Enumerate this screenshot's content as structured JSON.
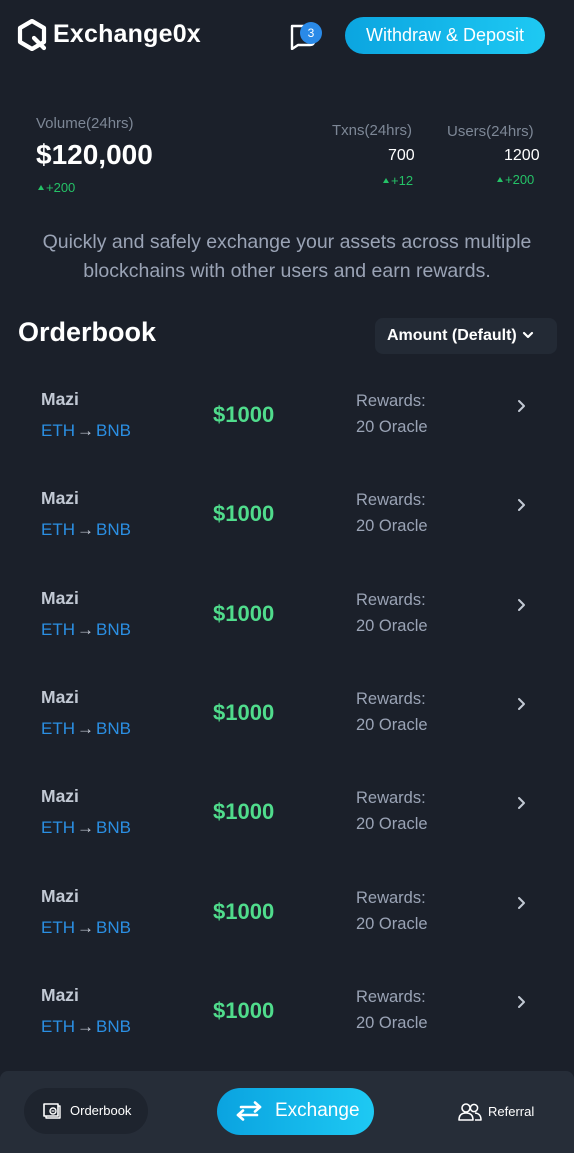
{
  "app": {
    "title": "Exchange0x"
  },
  "header": {
    "notification_count": "3",
    "withdraw_deposit_label": "Withdraw & Deposit"
  },
  "stats": {
    "volume": {
      "label": "Volume(24hrs)",
      "value": "$120,000",
      "delta": "+200"
    },
    "txns": {
      "label": "Txns(24hrs)",
      "value": "700",
      "delta": "+12"
    },
    "users": {
      "label": "Users(24hrs)",
      "value": "1200",
      "delta": "+200"
    }
  },
  "tagline": "Quickly and safely exchange your assets across multiple blockchains with other users and earn rewards.",
  "orderbook": {
    "title": "Orderbook",
    "sort_label": "Amount (Default)",
    "orders": [
      {
        "name": "Mazi",
        "from": "ETH",
        "arrow": "→",
        "to": "BNB",
        "amount": "$1000",
        "rewards_label": "Rewards:",
        "rewards_value": "20 Oracle"
      },
      {
        "name": "Mazi",
        "from": "ETH",
        "arrow": "→",
        "to": "BNB",
        "amount": "$1000",
        "rewards_label": "Rewards:",
        "rewards_value": "20 Oracle"
      },
      {
        "name": "Mazi",
        "from": "ETH",
        "arrow": "→",
        "to": "BNB",
        "amount": "$1000",
        "rewards_label": "Rewards:",
        "rewards_value": "20 Oracle"
      },
      {
        "name": "Mazi",
        "from": "ETH",
        "arrow": "→",
        "to": "BNB",
        "amount": "$1000",
        "rewards_label": "Rewards:",
        "rewards_value": "20 Oracle"
      },
      {
        "name": "Mazi",
        "from": "ETH",
        "arrow": "→",
        "to": "BNB",
        "amount": "$1000",
        "rewards_label": "Rewards:",
        "rewards_value": "20 Oracle"
      },
      {
        "name": "Mazi",
        "from": "ETH",
        "arrow": "→",
        "to": "BNB",
        "amount": "$1000",
        "rewards_label": "Rewards:",
        "rewards_value": "20 Oracle"
      },
      {
        "name": "Mazi",
        "from": "ETH",
        "arrow": "→",
        "to": "BNB",
        "amount": "$1000",
        "rewards_label": "Rewards:",
        "rewards_value": "20 Oracle"
      }
    ]
  },
  "bottom_nav": {
    "orderbook_label": "Orderbook",
    "exchange_label": "Exchange",
    "referral_label": "Referral"
  },
  "colors": {
    "background": "#1b202a",
    "accent": "#1ec9f3",
    "positive": "#25c267",
    "amount": "#50dc8c",
    "link": "#2b8fe3"
  },
  "icons": {
    "logo": "q-logo-icon",
    "notification": "chat-bubble-icon",
    "sort": "chevron-down-icon",
    "row": "chevron-right-icon",
    "nav_orderbook": "book-icon",
    "nav_exchange": "swap-arrows-icon",
    "nav_referral": "users-icon"
  }
}
